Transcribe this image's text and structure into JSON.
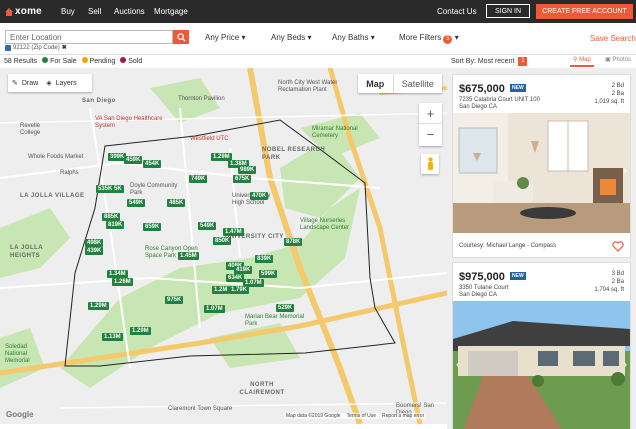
{
  "header": {
    "logo_text": "xome",
    "nav": [
      "Buy",
      "Sell",
      "Auctions",
      "Mortgage"
    ],
    "contact": "Contact Us",
    "signin": "SIGN IN",
    "create": "CREATE FREE ACCOUNT"
  },
  "search": {
    "placeholder": "Enter Location",
    "tag": "92122 (Zip Code)",
    "filters": [
      "Any Price",
      "Any Beds",
      "Any Baths",
      "More Filters"
    ],
    "more_filters_count": "5",
    "save": "Save Search"
  },
  "results": {
    "count": "58 Results",
    "legend": [
      "For Sale",
      "Pending",
      "Sold"
    ],
    "legend_colors": [
      "#21813f",
      "#f0a500",
      "#a8173a"
    ],
    "sort_label": "Sort By: Most recent",
    "sort_badge": "1",
    "view_map": "Map",
    "view_photos": "Photos"
  },
  "map": {
    "tab_map": "Map",
    "tab_satellite": "Satellite",
    "draw": "Draw",
    "layers": "Layers",
    "labels": [
      "Thornton Pavilion",
      "San Diego",
      "North City West Water Reclamation Plant",
      "VA San Diego Healthcare System",
      "Revelle College",
      "Whole Foods Market",
      "Ralphs",
      "LA JOLLA VILLAGE",
      "Miramar National Cemetery",
      "NOBEL RESEARCH PARK",
      "Doyle Community Park",
      "University City High School",
      "Village Nurseries Landscape Center",
      "UNIVERSITY CITY",
      "LA JOLLA HEIGHTS",
      "Rose Canyon Open Space Park",
      "Marian Bear Memorial Park",
      "Soledad National Memorial",
      "NORTH CLAIREMONT",
      "Claremont Town Square",
      "Boomers! San Diego",
      "Westfield UTC"
    ],
    "pins": [
      "399K",
      "459K",
      "454K",
      "1.29M",
      "1.38M",
      "989K",
      "675K",
      "749K",
      "535K",
      "5K",
      "549K",
      "485K",
      "470K",
      "885K",
      "819K",
      "659K",
      "549K",
      "1.47M",
      "850K",
      "878K",
      "498K",
      "439K",
      "1.45M",
      "839K",
      "408K",
      "419K",
      "599K",
      "1.34M",
      "1.26M",
      "634K",
      "1.07M",
      "1.2M",
      "1.79K",
      "975K",
      "1.29M",
      "1.07M",
      "529K",
      "1.29M",
      "1.13M"
    ],
    "attribution": [
      "Map data ©2019 Google",
      "Terms of Use",
      "Report a map error"
    ],
    "google": "Google"
  },
  "listings": [
    {
      "price": "$675,000",
      "badge": "NEW",
      "address1": "7235 Calabria Court UNIT 100",
      "address2": "San Diego CA",
      "beds": "2 Bd",
      "baths": "2 Ba",
      "sqft": "1,019 sq. ft",
      "courtesy": "Courtesy: Michael Lange - Compass"
    },
    {
      "price": "$975,000",
      "badge": "NEW",
      "address1": "3350 Tulane Court",
      "address2": "San Diego CA",
      "beds": "3 Bd",
      "baths": "2 Ba",
      "sqft": "1,704 sq. ft"
    }
  ]
}
